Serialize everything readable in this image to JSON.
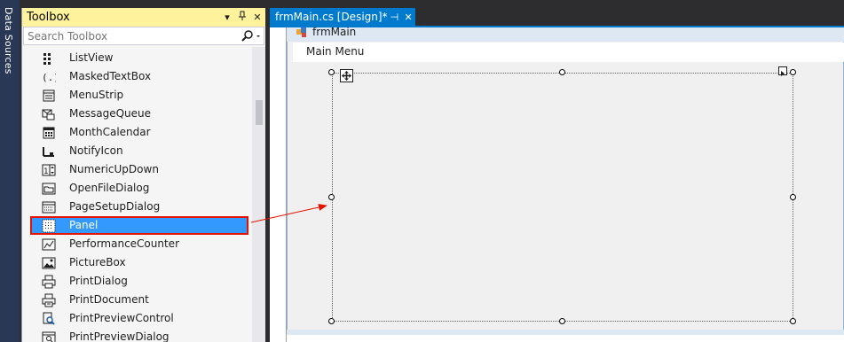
{
  "sidebar": {
    "data_sources_label": "Data Sources"
  },
  "toolbox": {
    "title": "Toolbox",
    "search_placeholder": "Search Toolbox",
    "header_buttons": [
      "dropdown-icon",
      "pin-icon",
      "close-icon"
    ],
    "items": [
      {
        "label": "ListView",
        "icon": "listview-icon"
      },
      {
        "label": "MaskedTextBox",
        "icon": "maskedtextbox-icon"
      },
      {
        "label": "MenuStrip",
        "icon": "menustrip-icon"
      },
      {
        "label": "MessageQueue",
        "icon": "messagequeue-icon"
      },
      {
        "label": "MonthCalendar",
        "icon": "monthcalendar-icon"
      },
      {
        "label": "NotifyIcon",
        "icon": "notifyicon-icon"
      },
      {
        "label": "NumericUpDown",
        "icon": "numericupdown-icon"
      },
      {
        "label": "OpenFileDialog",
        "icon": "openfiledialog-icon"
      },
      {
        "label": "PageSetupDialog",
        "icon": "pagesetupdialog-icon"
      },
      {
        "label": "Panel",
        "icon": "panel-icon",
        "selected": true
      },
      {
        "label": "PerformanceCounter",
        "icon": "performancecounter-icon"
      },
      {
        "label": "PictureBox",
        "icon": "picturebox-icon"
      },
      {
        "label": "PrintDialog",
        "icon": "printdialog-icon"
      },
      {
        "label": "PrintDocument",
        "icon": "printdocument-icon"
      },
      {
        "label": "PrintPreviewControl",
        "icon": "printpreviewcontrol-icon"
      },
      {
        "label": "PrintPreviewDialog",
        "icon": "printpreviewdialog-icon"
      }
    ]
  },
  "document_tab": {
    "title": "frmMain.cs [Design]*"
  },
  "form": {
    "title": "frmMain",
    "menu_item": "Main Menu"
  },
  "colors": {
    "selection": "#3399ff",
    "highlight_border": "#e51400",
    "toolbox_header": "#fff29d",
    "tab_active": "#007acc",
    "arrow": "#e51400"
  }
}
